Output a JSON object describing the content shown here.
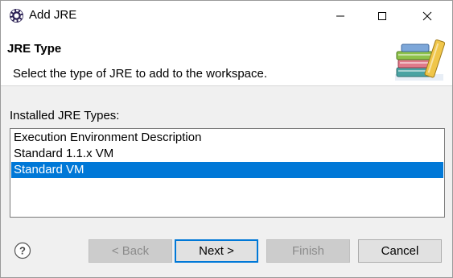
{
  "window": {
    "title": "Add JRE",
    "icons": {
      "app": "eclipse-icon",
      "minimize": "minimize-icon",
      "maximize": "maximize-icon",
      "close": "close-icon"
    }
  },
  "banner": {
    "title": "JRE Type",
    "description": "Select the type of JRE to add to the workspace.",
    "image": "books-icon"
  },
  "jre_types": {
    "label": "Installed JRE Types:",
    "items": [
      {
        "label": "Execution Environment Description",
        "selected": false
      },
      {
        "label": "Standard 1.1.x VM",
        "selected": false
      },
      {
        "label": "Standard VM",
        "selected": true
      }
    ],
    "selection_color": "#0078d7"
  },
  "buttons": {
    "help_icon": "help-icon",
    "back": "< Back",
    "next": "Next >",
    "finish": "Finish",
    "cancel": "Cancel"
  }
}
